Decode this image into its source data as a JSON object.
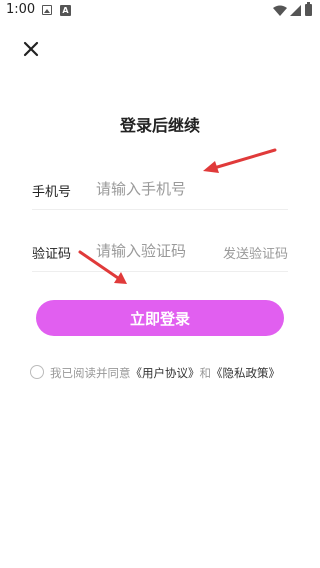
{
  "status_bar": {
    "time": "1:00",
    "icons": [
      "image-icon",
      "a-notification-icon",
      "wifi-icon",
      "signal-icon",
      "battery-icon"
    ]
  },
  "header": {
    "close_icon": "close-icon"
  },
  "page": {
    "title": "登录后继续"
  },
  "form": {
    "phone": {
      "label": "手机号",
      "placeholder": "请输入手机号",
      "value": ""
    },
    "code": {
      "label": "验证码",
      "placeholder": "请输入验证码",
      "value": "",
      "send_label": "发送验证码"
    }
  },
  "login_button": {
    "label": "立即登录"
  },
  "agreement": {
    "checked": false,
    "prefix": "我已阅读并同意",
    "user_agreement": "《用户协议》",
    "conjunction": "和",
    "privacy_policy": "《隐私政策》"
  },
  "colors": {
    "accent": "#e15ff0",
    "annotation_arrow": "#e03a3a",
    "placeholder": "#9a9a9a",
    "text": "#222222"
  }
}
